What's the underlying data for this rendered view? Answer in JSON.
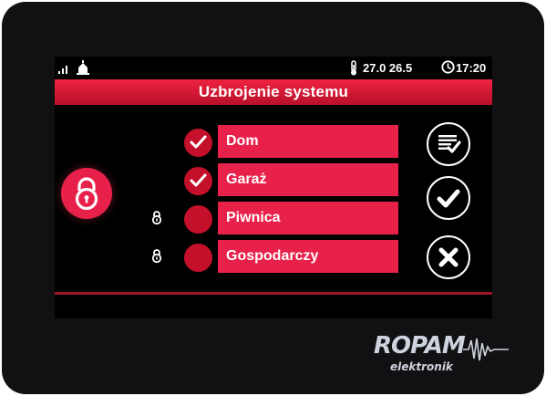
{
  "status_bar": {
    "signal_icon": "signal-bars-icon",
    "home_icon": "home-icon",
    "temperature": "27.0 26.5",
    "thermometer_icon": "thermometer-icon",
    "time": "17:20",
    "clock_icon": "clock-icon"
  },
  "header": {
    "title": "Uzbrojenie systemu"
  },
  "zones": [
    {
      "name": "Dom",
      "selected": true,
      "locked": false
    },
    {
      "name": "Garaż",
      "selected": true,
      "locked": false
    },
    {
      "name": "Piwnica",
      "selected": false,
      "locked": true
    },
    {
      "name": "Gospodarczy",
      "selected": false,
      "locked": true
    }
  ],
  "actions": {
    "select_all_icon": "checklist-icon",
    "confirm_icon": "checkmark-icon",
    "cancel_icon": "close-icon"
  },
  "brand": {
    "name": "ROPAM",
    "sub": "elektronik"
  },
  "colors": {
    "accent": "#e8214a",
    "background": "#000000",
    "bezel": "#111113"
  }
}
